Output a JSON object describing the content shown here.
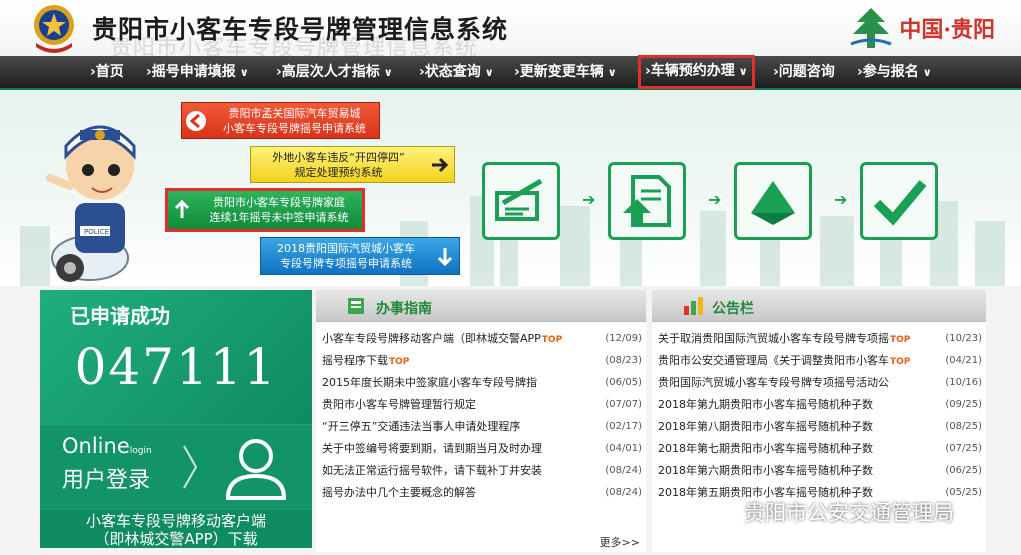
{
  "header": {
    "title": "贵阳市小客车专段号牌管理信息系统",
    "brand_text": "中国·贵阳"
  },
  "nav": [
    {
      "label": "›首页",
      "arrow": ""
    },
    {
      "label": "›摇号申请填报",
      "arrow": "∨"
    },
    {
      "label": "›高层次人才指标",
      "arrow": "∨"
    },
    {
      "label": "›状态查询",
      "arrow": "∨"
    },
    {
      "label": "›更新变更车辆",
      "arrow": "∨"
    },
    {
      "label": "›车辆预约办理",
      "arrow": "∨"
    },
    {
      "label": "›问题咨询",
      "arrow": ""
    },
    {
      "label": "›参与报名",
      "arrow": "∨"
    }
  ],
  "banner": {
    "red": {
      "line1": "贵阳市孟关国际汽车贸易城",
      "line2": "小客车专段号牌摇号申请系统"
    },
    "yellow": {
      "line1": "外地小客车违反“开四停四”",
      "line2": "规定处理预约系统"
    },
    "green": {
      "line1": "贵阳市小客车专段号牌家庭",
      "line2": "连续1年摇号未中签申请系统"
    },
    "blue": {
      "line1": "2018贵阳国际汽贸城小客车",
      "line2": "专段号牌专项摇号申请系统"
    }
  },
  "success": {
    "label": "已申请成功",
    "number": "047111",
    "login_en": "Online",
    "login_small": "login",
    "login_cn": "用户登录",
    "app_line1": "小客车专段号牌移动客户端",
    "app_line2": "（即林城交警APP）下载"
  },
  "guide": {
    "title": "办事指南",
    "more": "更多>>",
    "items": [
      {
        "text": "小客车专段号牌移动客户端（即林城交警APP",
        "top": "TOP",
        "date": "(12/09)"
      },
      {
        "text": "摇号程序下载",
        "top": "TOP",
        "date": "(08/23)"
      },
      {
        "text": "2015年度长期未中签家庭小客车专段号牌指",
        "top": "",
        "date": "(06/05)"
      },
      {
        "text": "贵阳市小客车号牌管理暂行规定",
        "top": "",
        "date": "(07/07)"
      },
      {
        "text": "“开三停五”交通违法当事人申请处理程序",
        "top": "",
        "date": "(02/17)"
      },
      {
        "text": "关于中签编号将要到期，请到期当月及时办理",
        "top": "",
        "date": "(04/01)"
      },
      {
        "text": "如无法正常运行摇号软件，请下载补丁并安装",
        "top": "",
        "date": "(08/24)"
      },
      {
        "text": "摇号办法中几个主要概念的解答",
        "top": "",
        "date": "(08/24)"
      }
    ]
  },
  "notice": {
    "title": "公告栏",
    "items": [
      {
        "text": "关于取消贵阳国际汽贸城小客车专段号牌专项摇",
        "top": "TOP",
        "date": "(10/23)"
      },
      {
        "text": "贵阳市公安交通管理局《关于调整贵阳市小客车",
        "top": "TOP",
        "date": "(04/21)"
      },
      {
        "text": "贵阳国际汽贸城小客车专段号牌专项摇号活动公",
        "top": "",
        "date": "(10/16)"
      },
      {
        "text": "2018年第九期贵阳市小客车摇号随机种子数",
        "top": "",
        "date": "(09/25)"
      },
      {
        "text": "2018年第八期贵阳市小客车摇号随机种子数",
        "top": "",
        "date": "(08/25)"
      },
      {
        "text": "2018年第七期贵阳市小客车摇号随机种子数",
        "top": "",
        "date": "(07/25)"
      },
      {
        "text": "2018年第六期贵阳市小客车摇号随机种子数",
        "top": "",
        "date": "(06/25)"
      },
      {
        "text": "2018年第五期贵阳市小客车摇号随机种子数",
        "top": "",
        "date": "(05/25)"
      }
    ]
  },
  "watermark": "贵阳市公安交通管理局",
  "colors": {
    "accent_green": "#1aa055",
    "highlight_red": "#e0302c",
    "nav_bg": "#2b2b2b",
    "top_orange": "#e85e12"
  }
}
